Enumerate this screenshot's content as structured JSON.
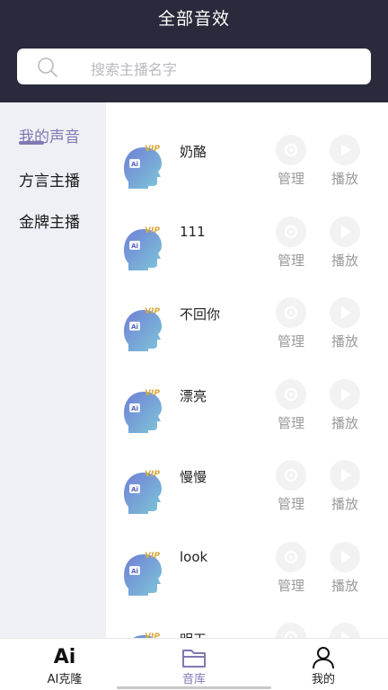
{
  "header": {
    "title": "全部音效"
  },
  "search": {
    "placeholder": "搜索主播名字"
  },
  "sidebar": {
    "items": [
      {
        "label": "我的声音",
        "active": true
      },
      {
        "label": "方言主播",
        "active": false
      },
      {
        "label": "金牌主播",
        "active": false
      }
    ]
  },
  "list": {
    "badge": "VIP",
    "avatar_text": "Ai",
    "manage_label": "管理",
    "play_label": "播放",
    "items": [
      {
        "name": "奶酪"
      },
      {
        "name": "111"
      },
      {
        "name": "不回你"
      },
      {
        "name": "漂亮"
      },
      {
        "name": "慢慢"
      },
      {
        "name": "look"
      },
      {
        "name": "明天"
      }
    ]
  },
  "tabbar": {
    "items": [
      {
        "label": "AI克隆",
        "icon": "ai-logo-icon",
        "active": false
      },
      {
        "label": "音库",
        "icon": "folder-icon",
        "active": true
      },
      {
        "label": "我的",
        "icon": "person-icon",
        "active": false
      }
    ],
    "ai_logo_text": "Ai"
  },
  "colors": {
    "header_bg": "#2a2a3c",
    "accent": "#8178b3",
    "sidebar_bg": "#eef0f5",
    "muted": "#9a9a9a"
  }
}
